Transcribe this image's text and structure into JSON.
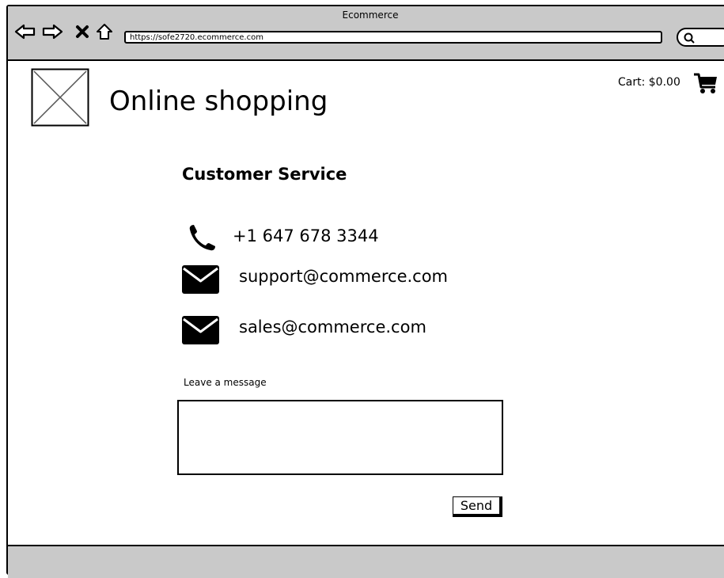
{
  "window": {
    "title": "Ecommerce"
  },
  "browser": {
    "url": "https://sofe2720.ecommerce.com",
    "nav": [
      "back-icon",
      "forward-icon",
      "stop-icon",
      "home-icon"
    ],
    "search_icon": "search-icon"
  },
  "header": {
    "logo_icon": "image-placeholder-icon",
    "title": "Online shopping",
    "cart_label": "Cart: $0.00",
    "cart_icon": "cart-icon"
  },
  "customer_service": {
    "title": "Customer Service",
    "phone": "+1 647 678 3344",
    "support_email": "support@commerce.com",
    "sales_email": "sales@commerce.com",
    "phone_icon": "phone-icon",
    "email_icon": "envelope-icon"
  },
  "message": {
    "label": "Leave a message",
    "value": "",
    "send_label": "Send"
  }
}
